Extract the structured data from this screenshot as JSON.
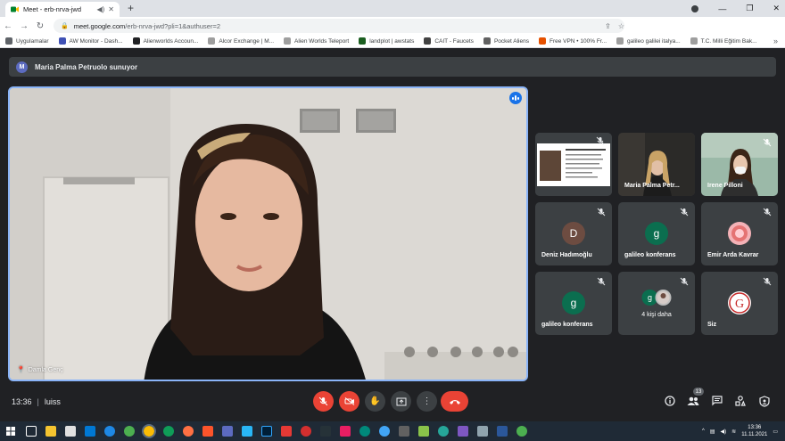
{
  "browser": {
    "tab_title": "Meet - erb-nrva-jwd",
    "url_host": "meet.google.com",
    "url_path": "/erb-nrva-jwd?pli=1&authuser=2",
    "bookmarks": [
      {
        "label": "Uygulamalar",
        "color": "#5f6368"
      },
      {
        "label": "AW Monitor - Dash...",
        "color": "#3f51b5"
      },
      {
        "label": "Alienworlds Accoun...",
        "color": "#202124"
      },
      {
        "label": "Alcor Exchange | M...",
        "color": "#9e9e9e"
      },
      {
        "label": "Alien Worlds Teleport",
        "color": "#9e9e9e"
      },
      {
        "label": "landplot | awstats",
        "color": "#1b5e20"
      },
      {
        "label": "CAIT - Faucets",
        "color": "#424242"
      },
      {
        "label": "Pocket Aliens",
        "color": "#616161"
      },
      {
        "label": "Free VPN • 100% Fr...",
        "color": "#e65100"
      },
      {
        "label": "galileo galilei italya...",
        "color": "#9e9e9e"
      },
      {
        "label": "T.C. Milli Eğitim Bak...",
        "color": "#9e9e9e"
      }
    ]
  },
  "meet": {
    "presenter_initial": "M",
    "presenting_text": "Maria Palma Petruolo sunuyor",
    "main_speaker": "Damla Genç",
    "participants": [
      {
        "name": "",
        "kind": "slide"
      },
      {
        "name": "Maria Palma Petr...",
        "kind": "video"
      },
      {
        "name": "Irene Pilloni",
        "kind": "video"
      },
      {
        "name": "Deniz Hadımoğlu",
        "kind": "avatar",
        "initial": "D",
        "color": "#6d4c41"
      },
      {
        "name": "galileo konferans",
        "kind": "avatar",
        "initial": "g",
        "color": "#0b6e4f"
      },
      {
        "name": "Emir Arda Kavrar",
        "kind": "photo"
      },
      {
        "name": "galileo konferans",
        "kind": "avatar",
        "initial": "g",
        "color": "#0b6e4f"
      },
      {
        "name": "4 kişi daha",
        "kind": "more",
        "initial": "g",
        "color": "#0b6e4f"
      },
      {
        "name": "Siz",
        "kind": "self"
      }
    ],
    "time": "13:36",
    "meeting_name": "luiss",
    "participants_count": "13"
  },
  "taskbar": {
    "time": "13:36",
    "date": "11.11.2021"
  }
}
